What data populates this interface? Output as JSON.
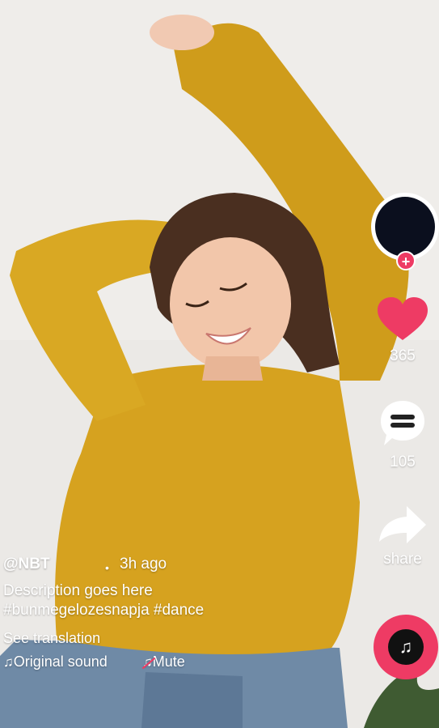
{
  "profile": {
    "follow_plus": "+"
  },
  "actions": {
    "likes": "365",
    "comments": "105",
    "share_label": "share"
  },
  "post": {
    "username": "@NBT",
    "dot": "•",
    "time_ago": "3h ago",
    "description": "Description goes here",
    "hashtags": "#bunmegelozesnapja #dance",
    "see_translation": "See translation",
    "sound_icon": "♫",
    "sound_label": "Original sound",
    "mute_icon": "♫",
    "mute_label": "Mute"
  },
  "music_disc": {
    "icon": "♫"
  },
  "colors": {
    "accent": "#ee3b64",
    "sweater": "#d6a21f",
    "background": "#e9e7e4"
  },
  "icons": [
    "heart-icon",
    "comment-bubble-icon",
    "share-arrow-icon",
    "music-note-icon",
    "mute-icon"
  ]
}
